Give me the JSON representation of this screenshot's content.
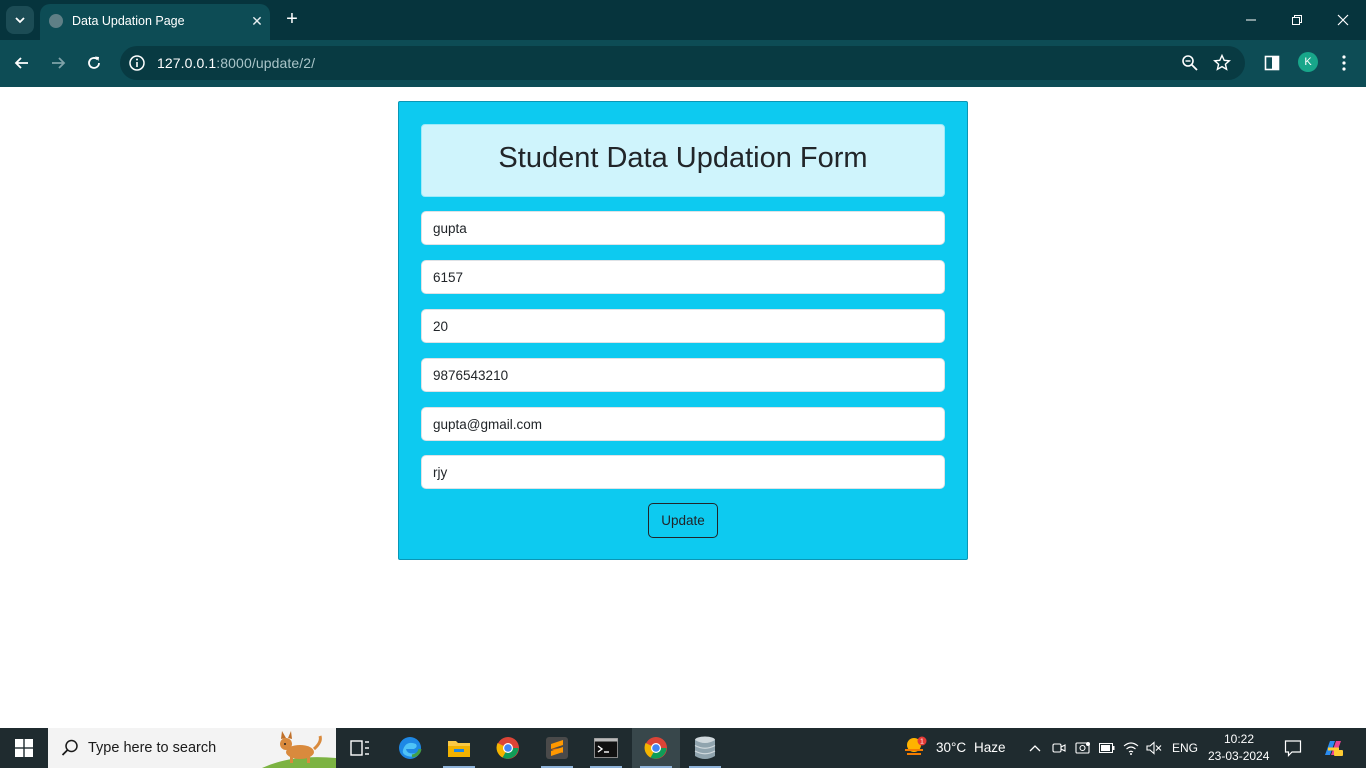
{
  "browser": {
    "tab_title": "Data Updation Page",
    "url_host": "127.0.0.1",
    "url_rest": ":8000/update/2/",
    "profile_initial": "K"
  },
  "form": {
    "title": "Student Data Updation Form",
    "fields": [
      {
        "value": "gupta"
      },
      {
        "value": "6157"
      },
      {
        "value": "20"
      },
      {
        "value": "9876543210"
      },
      {
        "value": "gupta@gmail.com"
      },
      {
        "value": "rjy"
      }
    ],
    "submit_label": "Update"
  },
  "taskbar": {
    "search_placeholder": "Type here to search",
    "weather_temp": "30°C",
    "weather_desc": "Haze",
    "weather_badge": "1",
    "language": "ENG",
    "time": "10:22",
    "date": "23-03-2024"
  },
  "colors": {
    "card_bg": "#0dcaf0",
    "heading_bg": "#cff4fc",
    "chrome_dark": "#06343d",
    "chrome_toolbar": "#0d4c55"
  }
}
